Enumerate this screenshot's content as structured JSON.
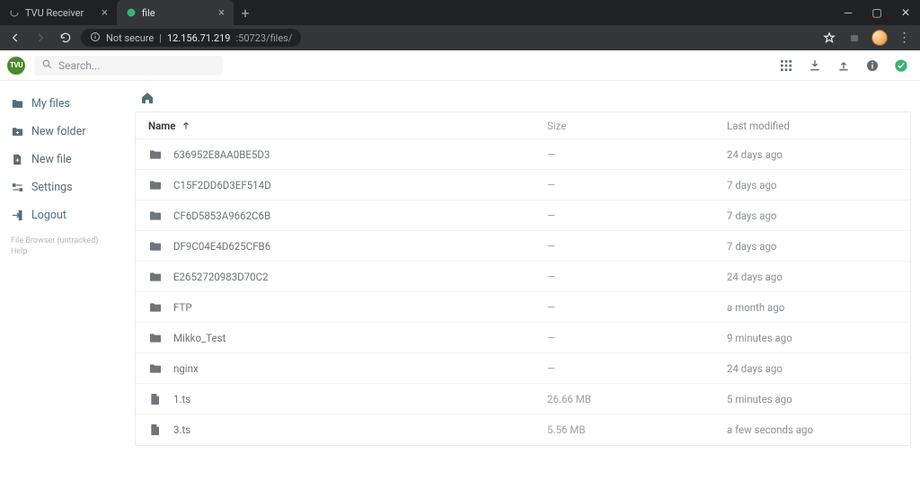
{
  "browser": {
    "tabs": [
      {
        "title": "TVU Receiver",
        "active": false
      },
      {
        "title": "file",
        "active": true
      }
    ],
    "security_label": "Not secure",
    "url_host": "12.156.71.219",
    "url_rest": ":50723/files/"
  },
  "app": {
    "logo_text": "TVU",
    "search_placeholder": "Search...",
    "footer_line1": "File Browser (untracked)",
    "footer_line2": "Help"
  },
  "sidebar": {
    "items": [
      {
        "id": "my-files",
        "label": "My files"
      },
      {
        "id": "new-folder",
        "label": "New folder"
      },
      {
        "id": "new-file",
        "label": "New file"
      },
      {
        "id": "settings",
        "label": "Settings"
      },
      {
        "id": "logout",
        "label": "Logout"
      }
    ]
  },
  "list": {
    "headers": {
      "name": "Name",
      "size": "Size",
      "modified": "Last modified"
    },
    "rows": [
      {
        "type": "folder",
        "name": "636952E8AA0BE5D3",
        "size": "—",
        "modified": "24 days ago"
      },
      {
        "type": "folder",
        "name": "C15F2DD6D3EF514D",
        "size": "—",
        "modified": "7 days ago"
      },
      {
        "type": "folder",
        "name": "CF6D5853A9662C6B",
        "size": "—",
        "modified": "7 days ago"
      },
      {
        "type": "folder",
        "name": "DF9C04E4D625CFB6",
        "size": "—",
        "modified": "7 days ago"
      },
      {
        "type": "folder",
        "name": "E2652720983D70C2",
        "size": "—",
        "modified": "24 days ago"
      },
      {
        "type": "folder",
        "name": "FTP",
        "size": "—",
        "modified": "a month ago"
      },
      {
        "type": "folder",
        "name": "Mikko_Test",
        "size": "—",
        "modified": "9 minutes ago"
      },
      {
        "type": "folder",
        "name": "nginx",
        "size": "—",
        "modified": "24 days ago"
      },
      {
        "type": "file",
        "name": "1.ts",
        "size": "26.66 MB",
        "modified": "5 minutes ago"
      },
      {
        "type": "file",
        "name": "3.ts",
        "size": "5.56 MB",
        "modified": "a few seconds ago"
      }
    ]
  }
}
